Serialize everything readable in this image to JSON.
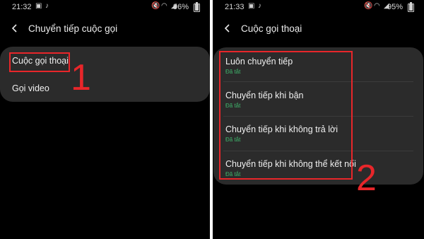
{
  "left": {
    "status": {
      "time": "21:32",
      "battery": "96%",
      "battery_level": 0.96
    },
    "title": "Chuyển tiếp cuộc gọi",
    "items": [
      {
        "label": "Cuộc gọi thoại"
      },
      {
        "label": "Gọi video"
      }
    ],
    "marker": "1"
  },
  "right": {
    "status": {
      "time": "21:33",
      "battery": "95%",
      "battery_level": 0.95
    },
    "title": "Cuộc gọi thoại",
    "items": [
      {
        "label": "Luôn chuyển tiếp",
        "status": "Đã tắt"
      },
      {
        "label": "Chuyển tiếp khi bận",
        "status": "Đã tắt"
      },
      {
        "label": "Chuyển tiếp khi không trả lời",
        "status": "Đã tắt"
      },
      {
        "label": "Chuyển tiếp khi không thể kết nối",
        "status": "Đã tắt"
      }
    ],
    "marker": "2"
  },
  "icons": {
    "status_left": [
      "image-icon",
      "tiktok-icon"
    ],
    "status_right": [
      "mute-icon",
      "wifi-icon",
      "signal-icon",
      "battery-icon"
    ],
    "back": "back-arrow-icon"
  },
  "colors": {
    "background": "#000000",
    "card": "#2b2b2b",
    "status_green": "#3fb56c",
    "highlight_red": "#e8262a"
  }
}
